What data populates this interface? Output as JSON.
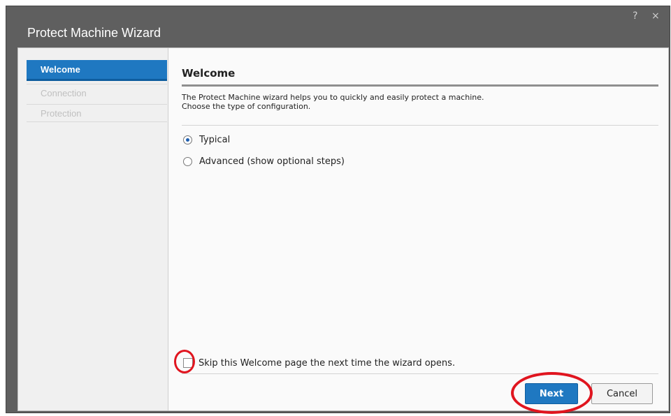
{
  "window": {
    "title": "Protect Machine Wizard",
    "help_label": "?",
    "close_label": "×"
  },
  "sidebar": {
    "items": [
      {
        "label": "Welcome",
        "state": "active"
      },
      {
        "label": "Connection",
        "state": "disabled"
      },
      {
        "label": "Protection",
        "state": "disabled"
      }
    ]
  },
  "main": {
    "title": "Welcome",
    "description_line1": "The Protect Machine wizard helps you to quickly and easily protect a machine.",
    "description_line2": "Choose the type of configuration.",
    "options": [
      {
        "label": "Typical",
        "selected": true
      },
      {
        "label": "Advanced (show optional steps)",
        "selected": false
      }
    ],
    "skip_label": "Skip this Welcome page the next time the wizard opens.",
    "skip_checked": false
  },
  "footer": {
    "next_label": "Next",
    "cancel_label": "Cancel"
  },
  "colors": {
    "accent": "#1f78c1",
    "annotation": "#e0151f",
    "titlebar": "#5f5f5f"
  }
}
